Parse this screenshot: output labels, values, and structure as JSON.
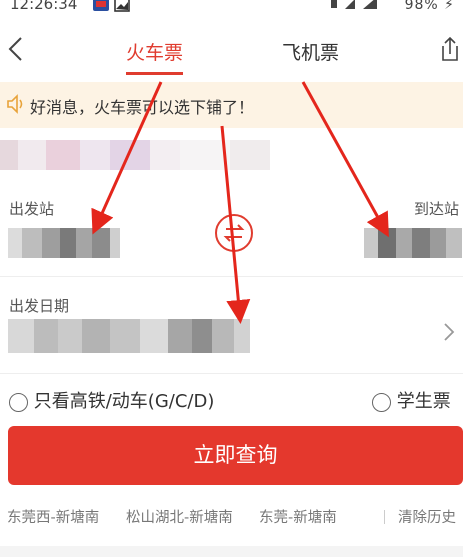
{
  "status": {
    "time": "12:26:34",
    "battery": "98%"
  },
  "tabs": {
    "train": "火车票",
    "flight": "飞机票"
  },
  "notice": {
    "text": "好消息，火车票可以选下铺了！"
  },
  "stations": {
    "from_label": "出发站",
    "to_label": "到达站"
  },
  "date": {
    "label": "出发日期"
  },
  "options": {
    "highspeed": "只看高铁/动车(G/C/D)",
    "student": "学生票"
  },
  "search": {
    "label": "立即查询"
  },
  "history": {
    "items": [
      "东莞西-新塘南",
      "松山湖北-新塘南",
      "东莞-新塘南"
    ],
    "clear": "清除历史"
  },
  "colors": {
    "accent": "#e03c2f",
    "button": "#e4382d",
    "notice_bg": "#fdf3e4"
  }
}
